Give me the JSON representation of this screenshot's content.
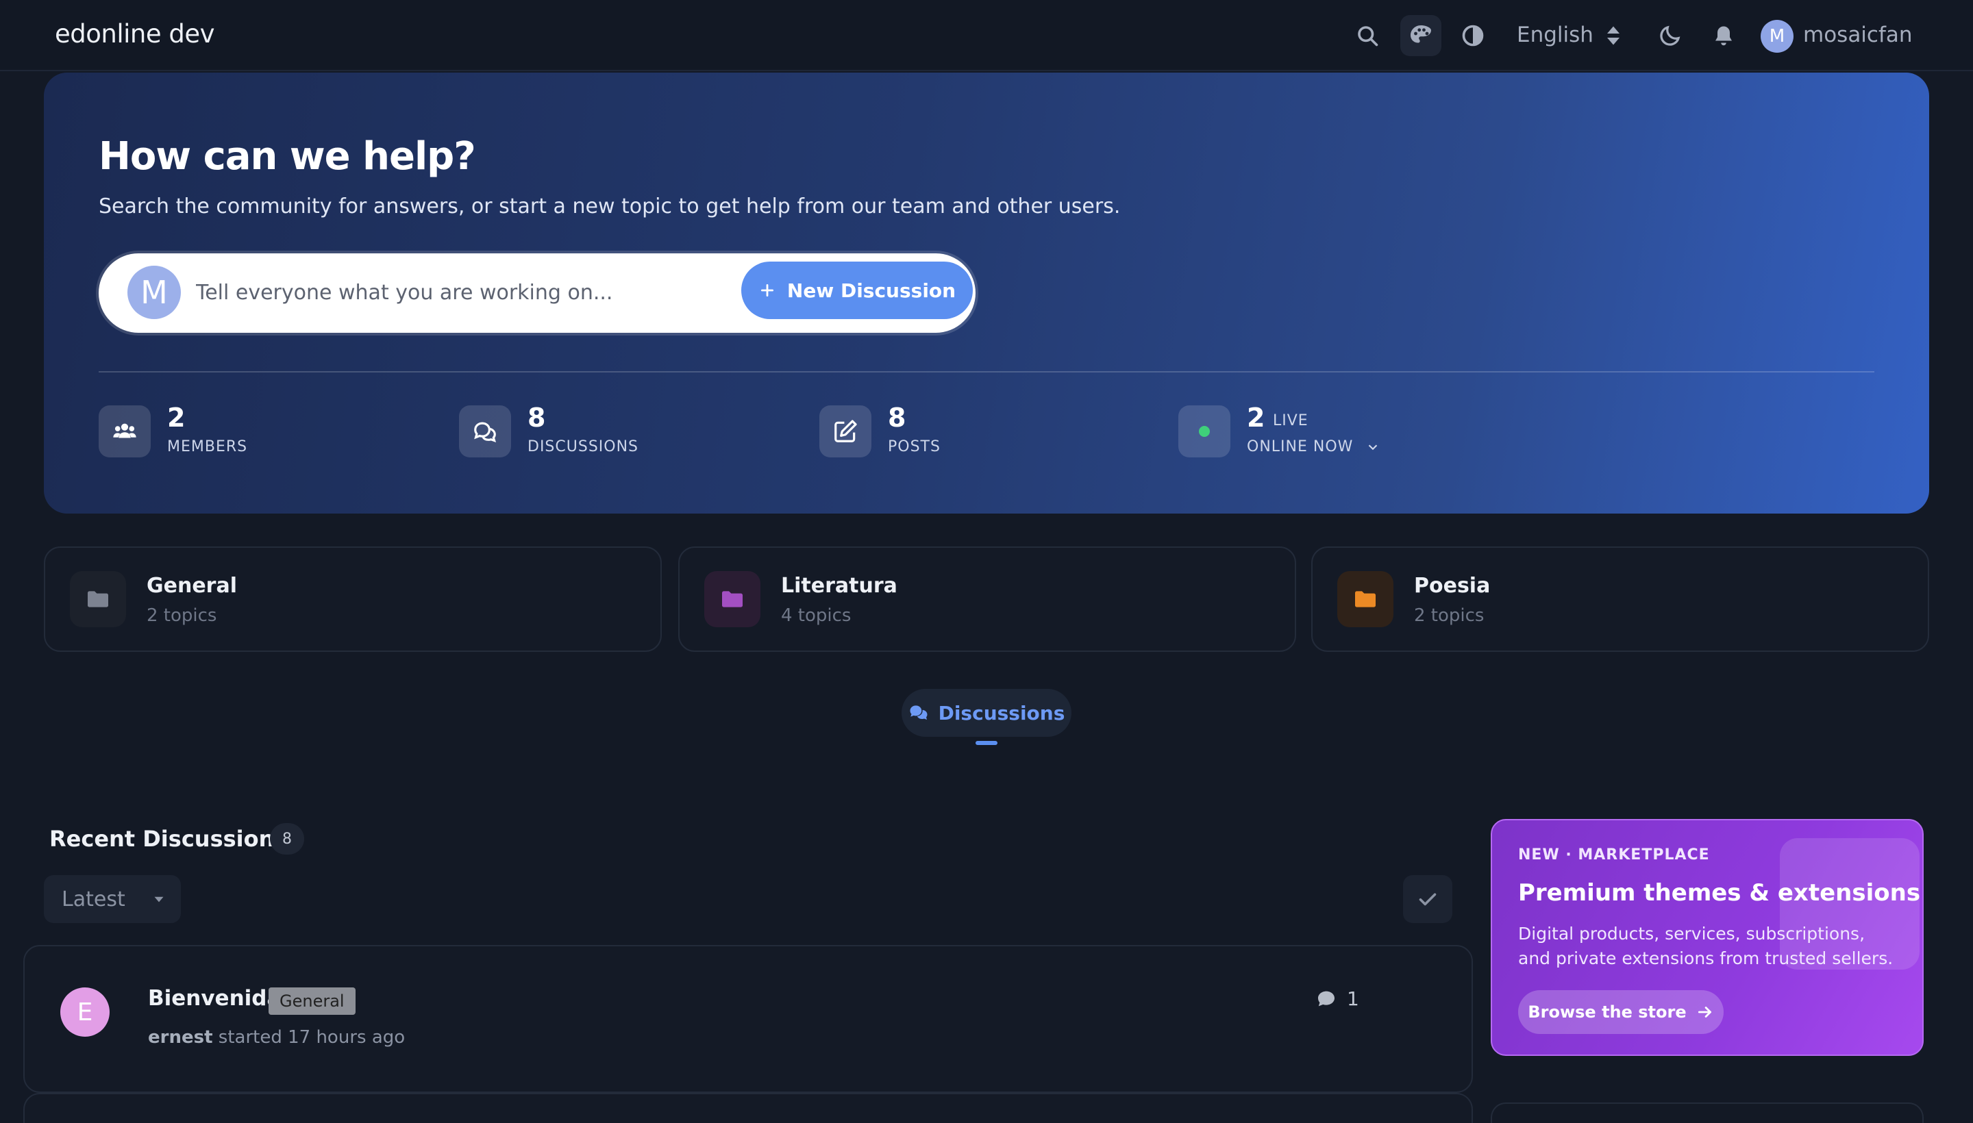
{
  "header": {
    "brand": "edonline dev",
    "language": "English",
    "user": {
      "initial": "M",
      "name": "mosaicfan"
    },
    "icons": [
      "search-icon",
      "palette-icon",
      "contrast-icon",
      "moon-icon",
      "bell-icon"
    ]
  },
  "hero": {
    "title": "How can we help?",
    "subtitle": "Search the community for answers, or start a new topic to get help from our team and other users.",
    "composer": {
      "avatar_initial": "M",
      "placeholder": "Tell everyone what you are working on...",
      "button_label": "New Discussion"
    },
    "stats": [
      {
        "value": "2",
        "label": "MEMBERS",
        "icon": "users-icon"
      },
      {
        "value": "8",
        "label": "DISCUSSIONS",
        "icon": "chat-icon"
      },
      {
        "value": "8",
        "label": "POSTS",
        "icon": "edit-icon"
      },
      {
        "value": "2",
        "live": "LIVE",
        "label": "ONLINE NOW",
        "icon": "online-dot"
      }
    ]
  },
  "categories": [
    {
      "name": "General",
      "count": "2 topics",
      "color": "#7d8391",
      "bg": "#1c212b"
    },
    {
      "name": "Literatura",
      "count": "4 topics",
      "color": "#a34fc2",
      "bg": "#2a1d33"
    },
    {
      "name": "Poesia",
      "count": "2 topics",
      "color": "#ec8a25",
      "bg": "#2f2219"
    }
  ],
  "tabs": {
    "active": "Discussions"
  },
  "recent": {
    "title": "Recent Discussions",
    "count": "8",
    "sort": "Latest",
    "items": [
      {
        "avatar_initial": "E",
        "title": "Bienvenida",
        "tag": "General",
        "author": "ernest",
        "meta": "started 17 hours ago",
        "replies": "1"
      }
    ]
  },
  "marketplace": {
    "eyebrow": "NEW · MARKETPLACE",
    "title": "Premium themes & extensions",
    "description": "Digital products, services, subscriptions, and private extensions from trusted sellers.",
    "button_label": "Browse the store"
  },
  "colors": {
    "accent": "#5b8ff0",
    "background": "#131925",
    "marketplace": "#8f3bde",
    "online": "#3fd07a"
  }
}
